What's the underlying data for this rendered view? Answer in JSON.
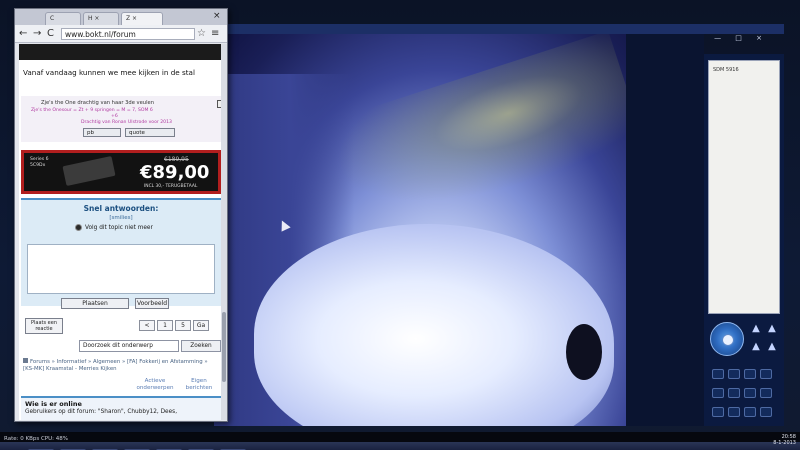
{
  "browser": {
    "tabs": [
      {
        "label": "C"
      },
      {
        "label": "H ×"
      },
      {
        "label": "Z ×"
      }
    ],
    "window_close": "×",
    "toolbar": {
      "back": "←",
      "forward": "→",
      "reload": "C",
      "url": "www.bokt.nl/forum",
      "star": "☆",
      "menu": "≡"
    },
    "post": {
      "text": "Vanaf vandaag kunnen we mee kijken in de stal",
      "signature": {
        "line1": "Zje's the One drachtig van haar 3de veulen",
        "line2": "Zje's the Onesour = Zt + 9 springen = M = 7, SOM 6",
        "line3": "+6",
        "line4": "Drachtig van Ronan Ulstrode voor 2013"
      },
      "pm_label": "pb",
      "quote_label": "quote"
    },
    "ad": {
      "series": "Series 6\n5C9Dx",
      "old_price": "€189,95",
      "price": "€89,00",
      "note": "INCL 30,- TERUGBETAAL"
    },
    "quick_reply": {
      "title": "Snel antwoorden:",
      "smilies": "[smilies]",
      "follow": "Volg dit topic niet meer",
      "place": "Plaatsen",
      "preview": "Voorbeeld"
    },
    "actions": {
      "new_reply": "Plaats een reactie",
      "pages": [
        "<",
        "1",
        "5",
        "Ga"
      ]
    },
    "search": {
      "placeholder": "Doorzoek dit onderwerp",
      "button": "Zoeken"
    },
    "breadcrumb": "Forums » Informatief » Algemeen » [FA] Fokkerij en Afstamming » [KS-MK] Kraamstal - Merries Kijken",
    "links": {
      "active": "Actieve onderwerpen",
      "own": "Eigen berichten"
    },
    "online": {
      "title": "Wie is er online",
      "users": "Gebruikers op dit forum: \"Sharon\", Chubby12, Dees,"
    }
  },
  "camera_app": {
    "window_controls": "— □ ×",
    "side_list_item": "SDM 5916"
  },
  "status": {
    "text": "Rate: 0 KBps  CPU:  48%",
    "clock_time": "20:58",
    "clock_date": "8-1-2013"
  }
}
